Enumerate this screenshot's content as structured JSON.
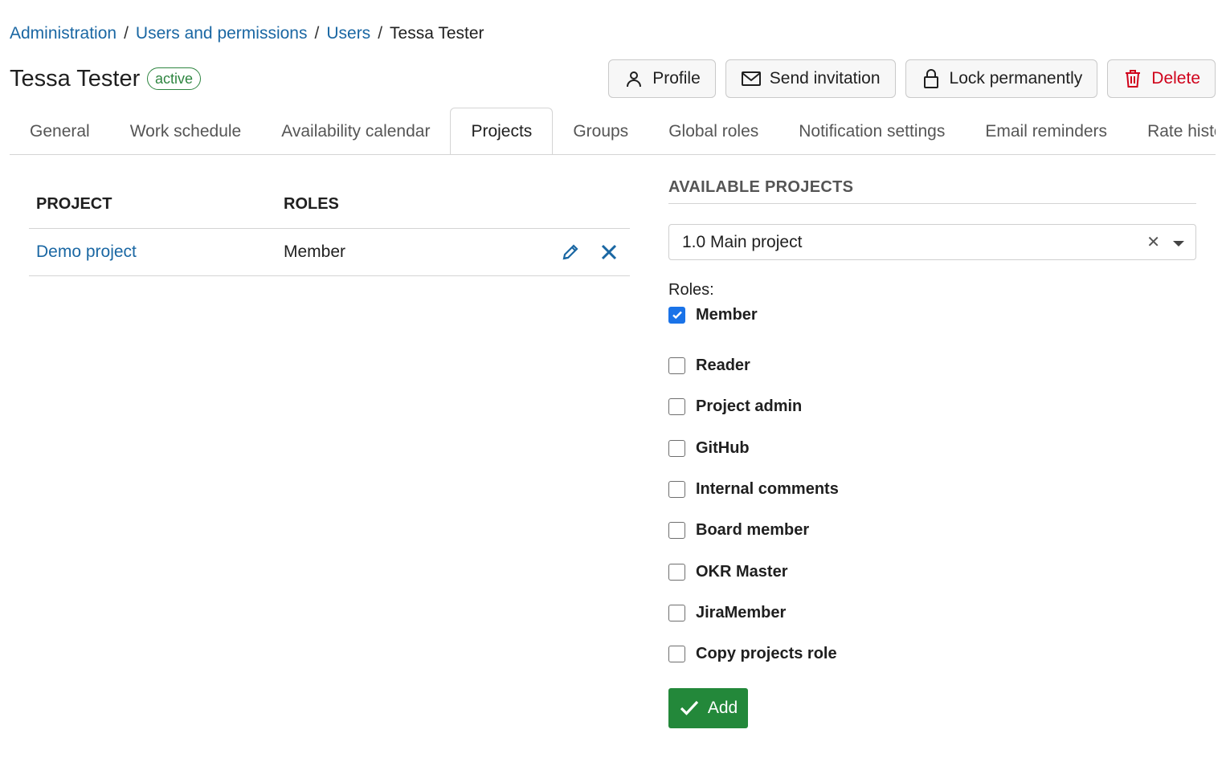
{
  "breadcrumb": {
    "items": [
      "Administration",
      "Users and permissions",
      "Users"
    ],
    "current": "Tessa Tester",
    "separator": "/"
  },
  "user": {
    "name": "Tessa Tester",
    "status": "active"
  },
  "toolbar": {
    "profile_label": "Profile",
    "invite_label": "Send invitation",
    "lock_label": "Lock permanently",
    "delete_label": "Delete"
  },
  "tabs": [
    {
      "label": "General",
      "active": false
    },
    {
      "label": "Work schedule",
      "active": false
    },
    {
      "label": "Availability calendar",
      "active": false
    },
    {
      "label": "Projects",
      "active": true
    },
    {
      "label": "Groups",
      "active": false
    },
    {
      "label": "Global roles",
      "active": false
    },
    {
      "label": "Notification settings",
      "active": false
    },
    {
      "label": "Email reminders",
      "active": false
    },
    {
      "label": "Rate history",
      "active": false
    }
  ],
  "projects_table": {
    "headers": {
      "project": "PROJECT",
      "roles": "ROLES"
    },
    "rows": [
      {
        "project": "Demo project",
        "roles": "Member"
      }
    ]
  },
  "available_projects": {
    "title": "AVAILABLE PROJECTS",
    "selected": "1.0 Main project",
    "roles_label": "Roles:",
    "roles": [
      {
        "label": "Member",
        "checked": true
      },
      {
        "label": "Reader",
        "checked": false
      },
      {
        "label": "Project admin",
        "checked": false
      },
      {
        "label": "GitHub",
        "checked": false
      },
      {
        "label": "Internal comments",
        "checked": false
      },
      {
        "label": "Board member",
        "checked": false
      },
      {
        "label": "OKR Master",
        "checked": false
      },
      {
        "label": "JiraMember",
        "checked": false
      },
      {
        "label": "Copy projects role",
        "checked": false
      }
    ],
    "add_label": "Add"
  },
  "colors": {
    "link": "#1a67a3",
    "active_badge": "#2e8540",
    "danger": "#d0021b",
    "add_button": "#23883a",
    "checkbox_checked": "#1a73e8"
  }
}
